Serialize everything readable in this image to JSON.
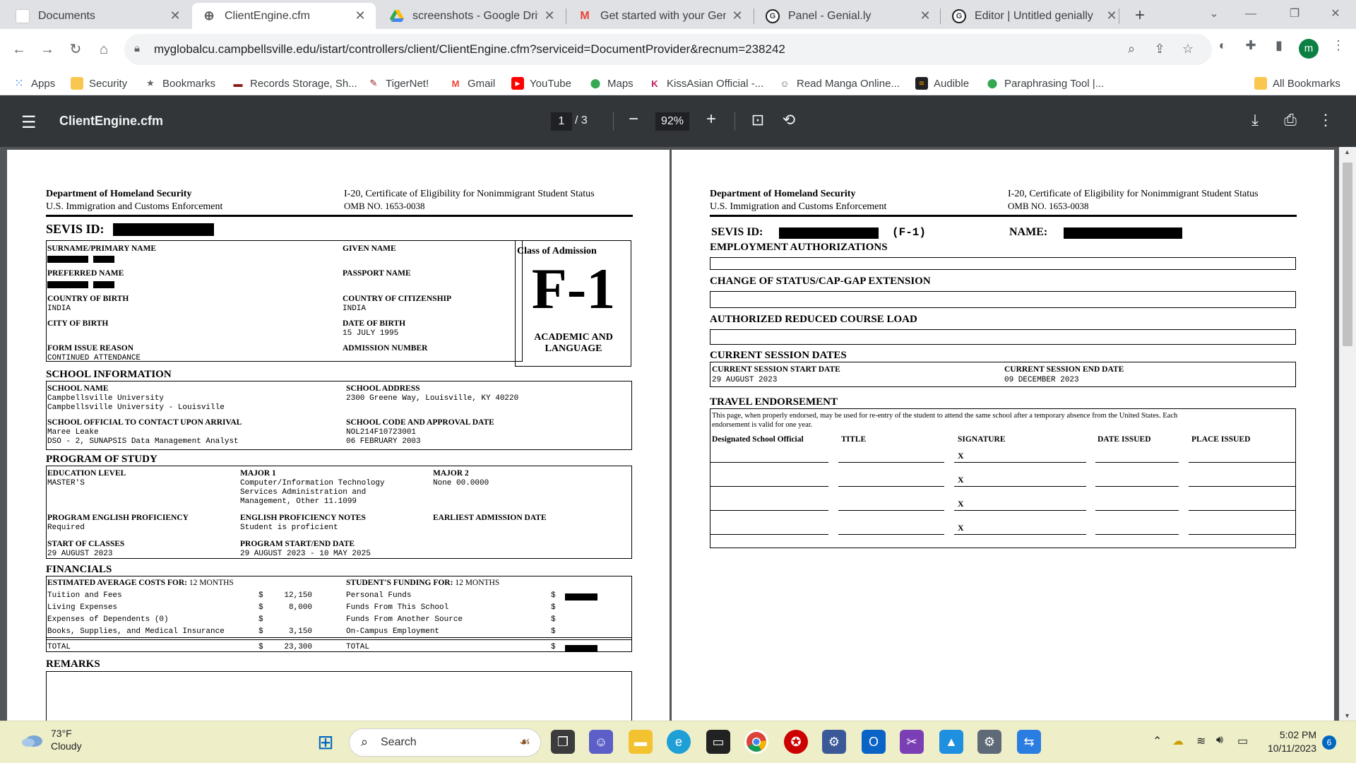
{
  "browser": {
    "tabs": [
      {
        "title": "Documents",
        "active": false
      },
      {
        "title": "ClientEngine.cfm",
        "active": true
      },
      {
        "title": "screenshots - Google Drive",
        "active": false
      },
      {
        "title": "Get started with your Genia",
        "active": false
      },
      {
        "title": "Panel - Genial.ly",
        "active": false
      },
      {
        "title": "Editor | Untitled genially",
        "active": false
      }
    ],
    "url": "myglobalcu.campbellsville.edu/istart/controllers/client/ClientEngine.cfm?serviceid=DocumentProvider&recnum=238242",
    "profile_initial": "m"
  },
  "bookmarks": {
    "items": [
      "Apps",
      "Security",
      "Bookmarks",
      "Records Storage, Sh...",
      "TigerNet!",
      "Gmail",
      "YouTube",
      "Maps",
      "KissAsian Official -...",
      "Read Manga Online...",
      "Audible",
      "Paraphrasing Tool |..."
    ],
    "all": "All Bookmarks"
  },
  "pdf": {
    "filename": "ClientEngine.cfm",
    "page_current": "1",
    "page_total": "/  3",
    "zoom": "92%"
  },
  "page1": {
    "dept": "Department of Homeland Security",
    "agency": "U.S. Immigration and Customs Enforcement",
    "form_title": "I-20, Certificate of Eligibility for Nonimmigrant Student Status",
    "omb": "OMB NO.  1653-0038",
    "sevis_label": "SEVIS ID:",
    "surname_label": "SURNAME/PRIMARY NAME",
    "given_label": "GIVEN NAME",
    "preferred_label": "PREFERRED NAME",
    "passport_label": "PASSPORT NAME",
    "cob_label": "COUNTRY OF BIRTH",
    "cob_value": "INDIA",
    "coc_label": "COUNTRY OF CITIZENSHIP",
    "coc_value": "INDIA",
    "city_label": "CITY OF BIRTH",
    "dob_label": "DATE OF BIRTH",
    "dob_value": "15 JULY 1995",
    "reason_label": "FORM ISSUE REASON",
    "reason_value": "CONTINUED ATTENDANCE",
    "admission_label": "ADMISSION NUMBER",
    "class_label": "Class of Admission",
    "class_value": "F-1",
    "class_sub1": "ACADEMIC AND",
    "class_sub2": "LANGUAGE",
    "school_info": "SCHOOL INFORMATION",
    "school_name_label": "SCHOOL NAME",
    "school_name_1": "Campbellsville University",
    "school_name_2": "Campbellsville University - Louisville",
    "school_addr_label": "SCHOOL ADDRESS",
    "school_addr": "2300 Greene Way, Louisville, KY 40220",
    "official_label": "SCHOOL OFFICIAL TO CONTACT UPON ARRIVAL",
    "official_name": "Maree Leake",
    "official_title": "DSO - 2, SUNAPSIS Data Management Analyst",
    "code_label": "SCHOOL CODE AND APPROVAL DATE",
    "code_value": "NOL214F10723001",
    "code_date": "06 FEBRUARY 2003",
    "program": "PROGRAM OF STUDY",
    "edu_label": "EDUCATION LEVEL",
    "edu_value": "MASTER'S",
    "major1_label": "MAJOR 1",
    "major1_l1": "Computer/Information Technology",
    "major1_l2": "Services Administration and",
    "major1_l3": "Management, Other 11.1099",
    "major2_label": "MAJOR 2",
    "major2_value": "None 00.0000",
    "epp_label": "PROGRAM ENGLISH PROFICIENCY",
    "epp_value": "Required",
    "epn_label": "ENGLISH PROFICIENCY NOTES",
    "epn_value": "Student is proficient",
    "earliest_label": "EARLIEST ADMISSION DATE",
    "start_label": "START OF CLASSES",
    "start_value": "29 AUGUST 2023",
    "psed_label": "PROGRAM START/END DATE",
    "psed_value": "29 AUGUST 2023 - 10 MAY 2025",
    "financials": "FINANCIALS",
    "est_label": "ESTIMATED AVERAGE COSTS FOR:",
    "est_months": "12 MONTHS",
    "fund_label": "STUDENT'S FUNDING FOR:",
    "fund_months": "12 MONTHS",
    "costs": [
      {
        "item": "Tuition and Fees",
        "cur": "$",
        "amount": "12,150"
      },
      {
        "item": "Living Expenses",
        "cur": "$",
        "amount": "8,000"
      },
      {
        "item": "Expenses of Dependents (0)",
        "cur": "$",
        "amount": ""
      },
      {
        "item": "Books, Supplies, and Medical Insurance",
        "cur": "$",
        "amount": "3,150"
      }
    ],
    "funds": [
      {
        "item": "Personal Funds",
        "cur": "$"
      },
      {
        "item": "Funds From This School",
        "cur": "$"
      },
      {
        "item": "Funds From Another Source",
        "cur": "$"
      },
      {
        "item": "On-Campus Employment",
        "cur": "$"
      }
    ],
    "total_label": "TOTAL",
    "total_cur": "$",
    "total_cost": "23,300",
    "remarks": "REMARKS"
  },
  "page2": {
    "dept": "Department of Homeland Security",
    "agency": "U.S. Immigration and Customs Enforcement",
    "form_title": "I-20, Certificate of Eligibility for Nonimmigrant Student Status",
    "omb": "OMB NO.  1653-0038",
    "sevis_label": "SEVIS ID:",
    "f1": "(F-1)",
    "name_label": "NAME:",
    "employment": "EMPLOYMENT AUTHORIZATIONS",
    "cos": "CHANGE OF STATUS/CAP-GAP EXTENSION",
    "rcl": "AUTHORIZED REDUCED COURSE LOAD",
    "csd": "CURRENT SESSION DATES",
    "start_label": "CURRENT SESSION START DATE",
    "start_value": "29 AUGUST 2023",
    "end_label": "CURRENT SESSION END DATE",
    "end_value": "09 DECEMBER 2023",
    "travel": "TRAVEL ENDORSEMENT",
    "travel_text_1": "This page, when properly endorsed, may be used for re-entry of the student to attend the same school after a temporary absence from the United States. Each",
    "travel_text_2": "endorsement is valid for one year.",
    "col_dso": "Designated School Official",
    "col_title": "TITLE",
    "col_sig": "SIGNATURE",
    "col_date": "DATE ISSUED",
    "col_place": "PLACE ISSUED",
    "sig_mark": "X"
  },
  "taskbar": {
    "temp": "73°F",
    "condition": "Cloudy",
    "search": "Search",
    "time": "5:02 PM",
    "date": "10/11/2023",
    "notifications": "6"
  }
}
